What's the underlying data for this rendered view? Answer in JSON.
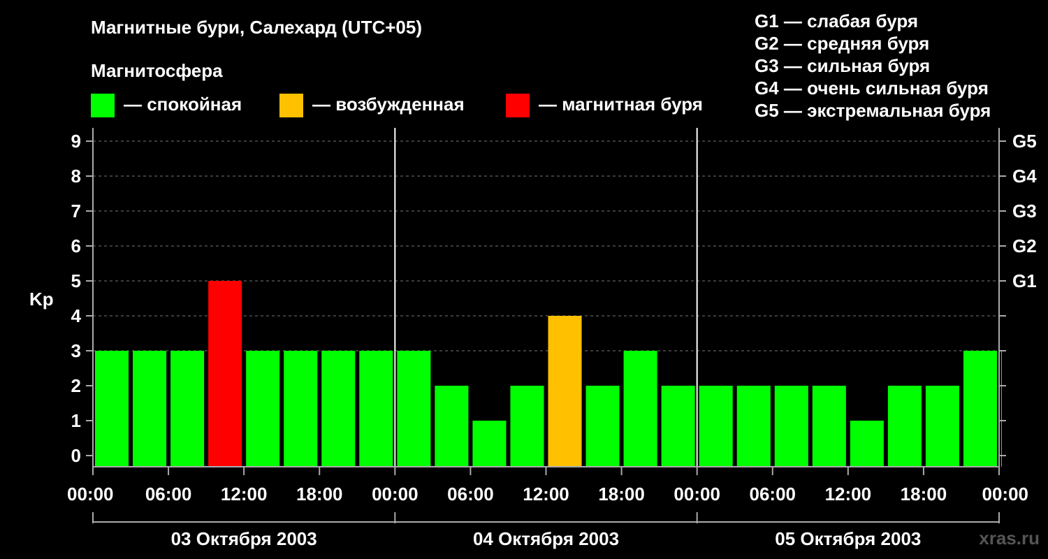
{
  "title": "Магнитные бури, Салехард (UTC+05)",
  "subtitle": "Магнитосфера",
  "legend": [
    {
      "label": "— спокойная",
      "color": "#00ff00"
    },
    {
      "label": "— возбужденная",
      "color": "#ffc000"
    },
    {
      "label": "— магнитная буря",
      "color": "#ff0000"
    }
  ],
  "storm_scale": [
    "G1 — слабая буря",
    "G2 — средняя буря",
    "G3 — сильная буря",
    "G4 — очень сильная буря",
    "G5 — экстремальная буря"
  ],
  "site": "xras.ru",
  "chart_data": {
    "type": "bar",
    "ylabel": "Kp",
    "ylim": [
      0,
      9
    ],
    "yticks": [
      0,
      1,
      2,
      3,
      4,
      5,
      6,
      7,
      8,
      9
    ],
    "y2ticks": [
      {
        "value": 5,
        "label": "G1"
      },
      {
        "value": 6,
        "label": "G2"
      },
      {
        "value": 7,
        "label": "G3"
      },
      {
        "value": 8,
        "label": "G4"
      },
      {
        "value": 9,
        "label": "G5"
      }
    ],
    "xticks": [
      "00:00",
      "06:00",
      "12:00",
      "18:00",
      "00:00",
      "06:00",
      "12:00",
      "18:00",
      "00:00",
      "06:00",
      "12:00",
      "18:00",
      "00:00"
    ],
    "days": [
      "03 Октября 2003",
      "04 Октября 2003",
      "05 Октября 2003"
    ],
    "bar_interval_hours": 3,
    "values": [
      3,
      3,
      3,
      5,
      3,
      3,
      3,
      3,
      3,
      2,
      1,
      2,
      4,
      2,
      3,
      2,
      2,
      2,
      2,
      2,
      1,
      2,
      2,
      3,
      3
    ],
    "colors": {
      "calm": "#00ff00",
      "active": "#ffc000",
      "storm": "#ff0000"
    },
    "grid": true
  }
}
